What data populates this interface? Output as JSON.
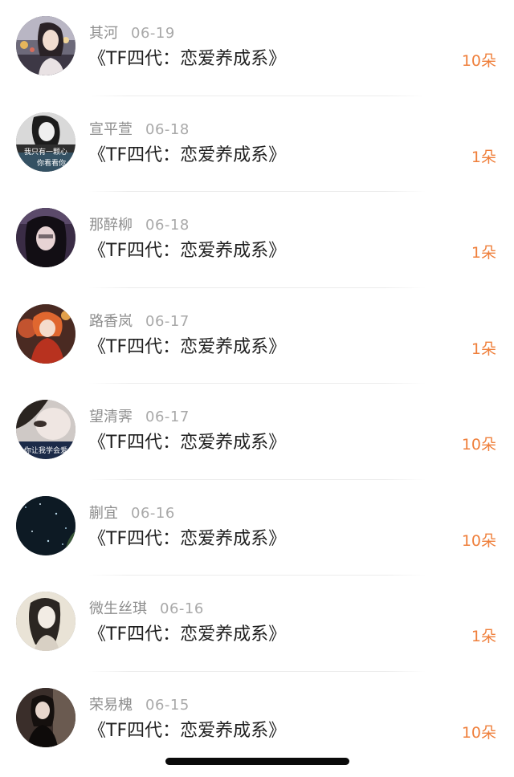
{
  "gift_list": {
    "items": [
      {
        "name": "其河",
        "date": "06-19",
        "title": "《TF四代：恋爱养成系》",
        "amount": "10朵",
        "avatar": "avatar-girl-city-lights"
      },
      {
        "name": "宣平萱",
        "date": "06-18",
        "title": "《TF四代：恋爱养成系》",
        "amount": "1朵",
        "avatar": "avatar-girl-bw",
        "avatar_caption_1": "我只有一颗心",
        "avatar_caption_2": "你看看你"
      },
      {
        "name": "那醉柳",
        "date": "06-18",
        "title": "《TF四代：恋爱养成系》",
        "amount": "1朵",
        "avatar": "avatar-girl-dark"
      },
      {
        "name": "路香岚",
        "date": "06-17",
        "title": "《TF四代：恋爱养成系》",
        "amount": "1朵",
        "avatar": "avatar-girl-red-dress"
      },
      {
        "name": "望清霁",
        "date": "06-17",
        "title": "《TF四代：恋爱养成系》",
        "amount": "10朵",
        "avatar": "avatar-girl-blur",
        "avatar_caption_1": "你让我学会爱"
      },
      {
        "name": "蒯宜",
        "date": "06-16",
        "title": "《TF四代：恋爱养成系》",
        "amount": "10朵",
        "avatar": "avatar-night-sky"
      },
      {
        "name": "微生丝琪",
        "date": "06-16",
        "title": "《TF四代：恋爱养成系》",
        "amount": "1朵",
        "avatar": "avatar-girl-sketch"
      },
      {
        "name": "荣易槐",
        "date": "06-15",
        "title": "《TF四代：恋爱养成系》",
        "amount": "10朵",
        "avatar": "avatar-girl-dark-room"
      }
    ]
  },
  "colors": {
    "amount": "#ef7f3b",
    "name": "#8e8e8e",
    "date": "#a9a9a9",
    "title": "#1f1f1f",
    "home_indicator": "#0a0a0a"
  }
}
